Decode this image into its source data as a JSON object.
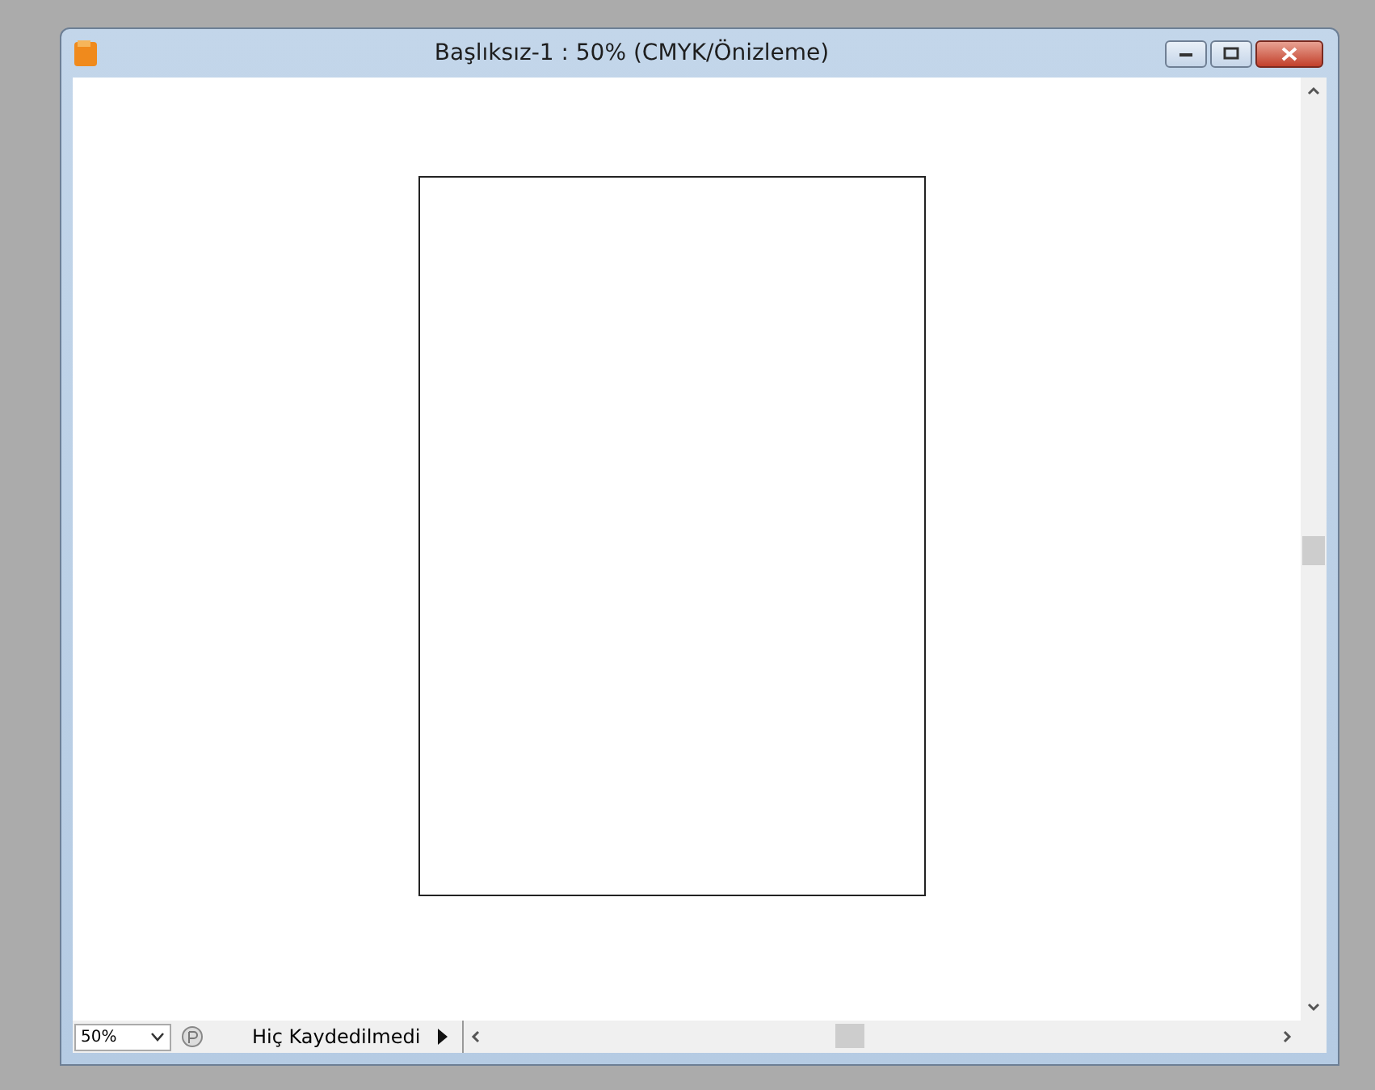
{
  "window": {
    "title": "Başlıksız-1 : 50% (CMYK/Önizleme)"
  },
  "status_bar": {
    "zoom": "50%",
    "status": "Hiç Kaydedilmedi"
  }
}
